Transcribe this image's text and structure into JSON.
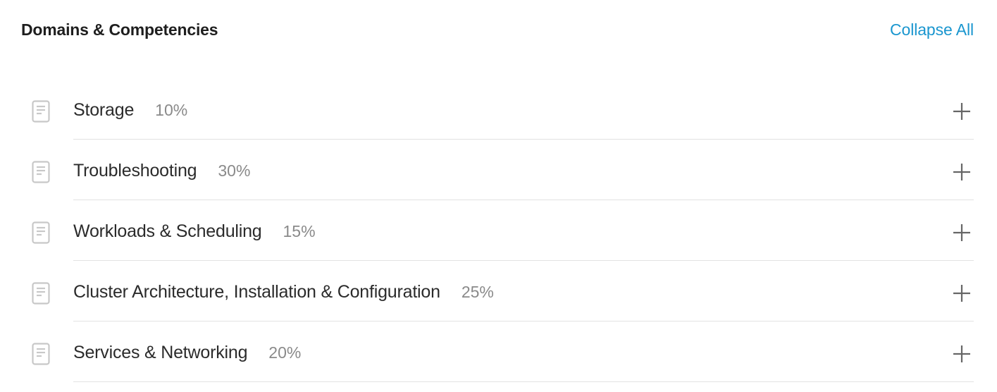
{
  "header": {
    "title": "Domains & Competencies",
    "collapse_label": "Collapse All"
  },
  "domains": [
    {
      "name": "Storage",
      "percent": "10%",
      "icon": "document-icon",
      "toggle": "plus-icon"
    },
    {
      "name": "Troubleshooting",
      "percent": "30%",
      "icon": "document-icon",
      "toggle": "plus-icon"
    },
    {
      "name": "Workloads & Scheduling",
      "percent": "15%",
      "icon": "document-icon",
      "toggle": "plus-icon"
    },
    {
      "name": "Cluster Architecture, Installation & Configuration",
      "percent": "25%",
      "icon": "document-icon",
      "toggle": "plus-icon"
    },
    {
      "name": "Services & Networking",
      "percent": "20%",
      "icon": "document-icon",
      "toggle": "plus-icon"
    }
  ],
  "colors": {
    "accent": "#1a96cf",
    "text": "#2b2b2b",
    "muted": "#8a8a8a",
    "divider": "#e2e2e2",
    "icon": "#c8c8c8"
  }
}
